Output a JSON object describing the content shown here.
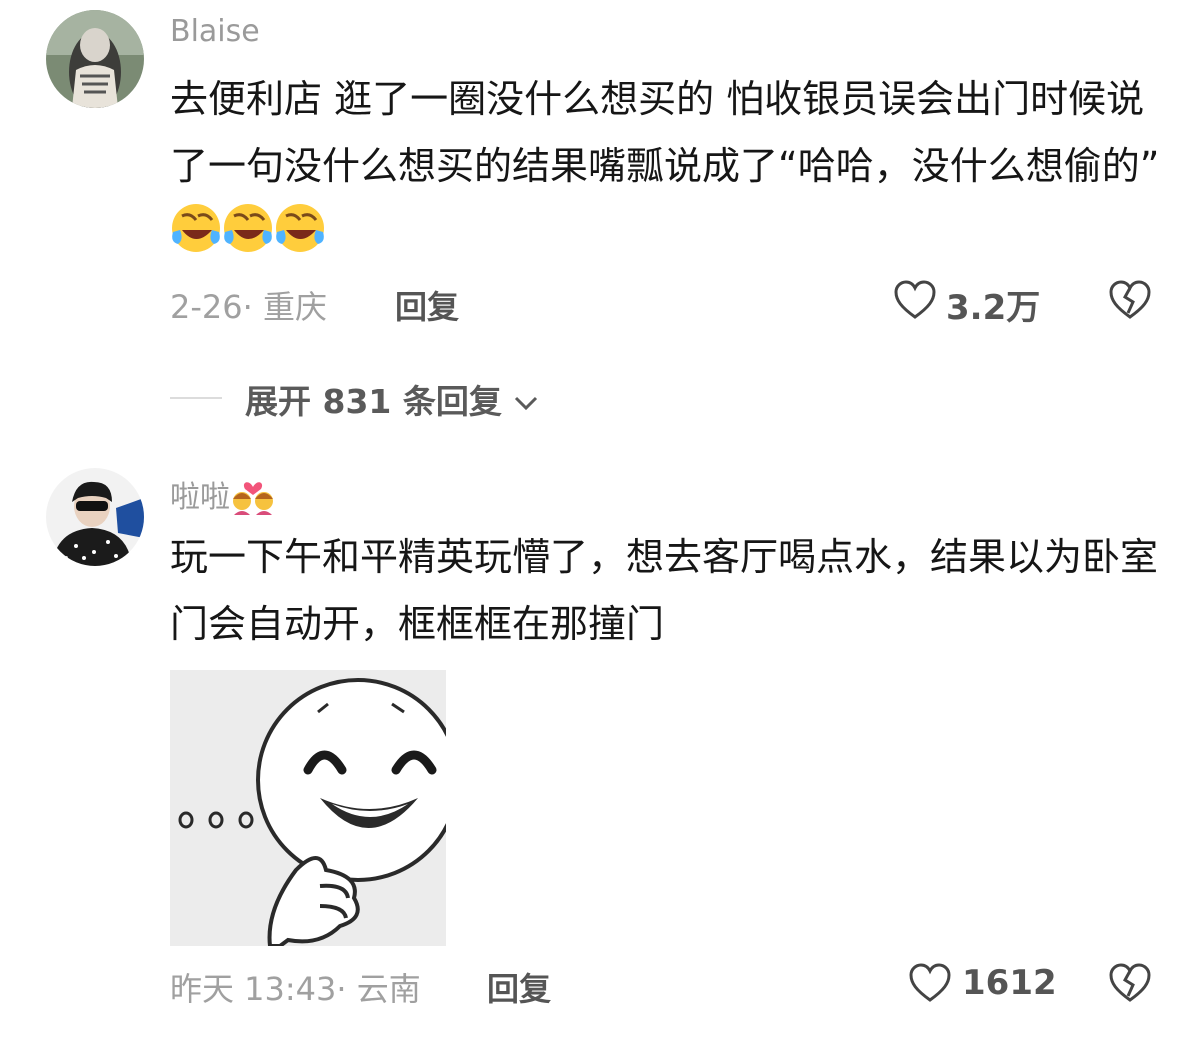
{
  "comments": [
    {
      "username": "Blaise",
      "text": "去便利店 逛了一圈没什么想买的 怕收银员误会出门时候说了一句没什么想买的结果嘴瓢说成了“哈哈，没什么想偷的”",
      "emoji_count": 3,
      "date_location": "2-26· 重庆",
      "reply_label": "回复",
      "likes": "3.2万",
      "expand_replies": "展开 831 条回复"
    },
    {
      "username": "啦啦",
      "username_emoji": "couple-with-heart-emoji",
      "text": "玩一下午和平精英玩懵了，想去客厅喝点水，结果以为卧室门会自动开，框框框在那撞门",
      "date_location": "昨天 13:43· 云南",
      "reply_label": "回复",
      "likes": "1612",
      "sticker": "smiling-thinking-face-sticker"
    }
  ],
  "colors": {
    "text": "#161616",
    "meta": "#a0a0a0",
    "action": "#555555",
    "background": "#ffffff"
  }
}
